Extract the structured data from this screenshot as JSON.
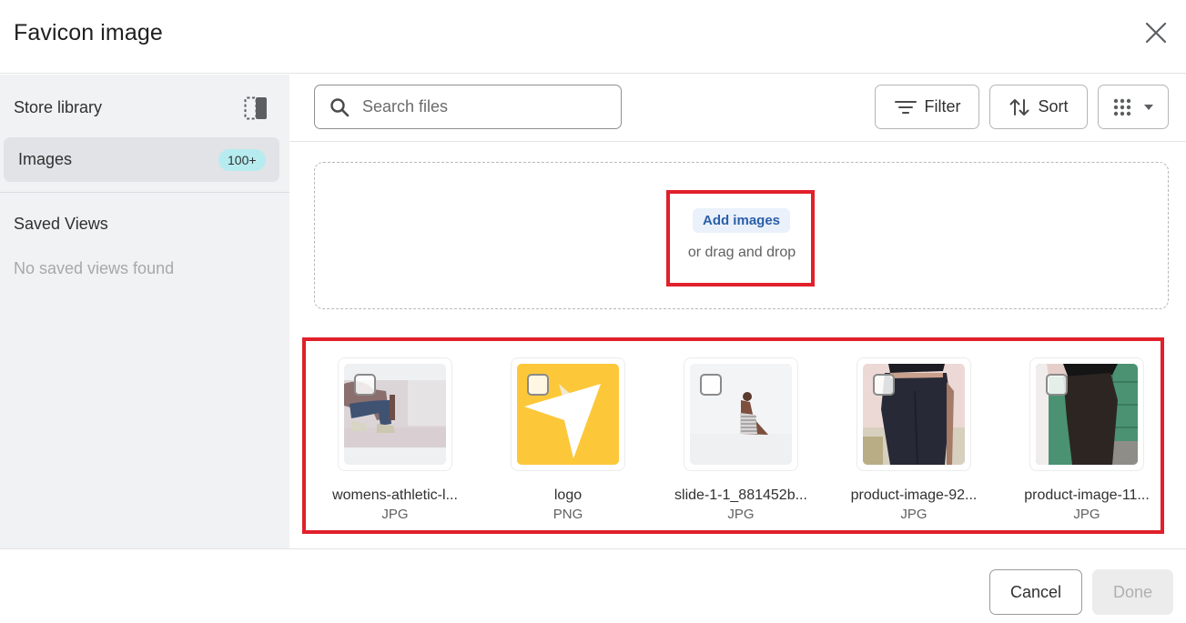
{
  "dialog": {
    "title": "Favicon image",
    "close_icon": "close-icon"
  },
  "sidebar": {
    "heading": "Store library",
    "toggle_icon": "sidebar-toggle-icon",
    "items": [
      {
        "label": "Images",
        "badge": "100+",
        "selected": true
      }
    ],
    "saved_views_heading": "Saved Views",
    "saved_views_empty": "No saved views found"
  },
  "toolbar": {
    "search": {
      "placeholder": "Search files",
      "value": ""
    },
    "filter_label": "Filter",
    "sort_label": "Sort",
    "view_icon": "grid-view-icon"
  },
  "dropzone": {
    "add_label": "Add images",
    "hint": "or drag and drop"
  },
  "files": [
    {
      "name": "womens-athletic-l...",
      "type": "JPG",
      "thumb": "person-crouching-photo",
      "checked": false
    },
    {
      "name": "logo",
      "type": "PNG",
      "thumb": "yellow-star-logo",
      "checked": false
    },
    {
      "name": "slide-1-1_881452b...",
      "type": "JPG",
      "thumb": "woman-sitting-photo",
      "checked": false
    },
    {
      "name": "product-image-92...",
      "type": "JPG",
      "thumb": "black-leggings-photo",
      "checked": false
    },
    {
      "name": "product-image-11...",
      "type": "JPG",
      "thumb": "leggings-green-wall-photo",
      "checked": false
    }
  ],
  "footer": {
    "cancel_label": "Cancel",
    "done_label": "Done",
    "done_disabled": true
  },
  "colors": {
    "highlight": "#e0202a",
    "badge": "#b6ecf0",
    "add_link": "#2b5fa8"
  }
}
